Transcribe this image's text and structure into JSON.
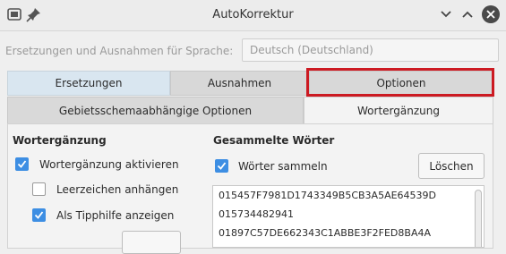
{
  "window": {
    "title": "AutoKorrektur"
  },
  "language": {
    "label": "Ersetzungen und Ausnahmen für Sprache:",
    "selected": "Deutsch (Deutschland)"
  },
  "tabs": {
    "row1": [
      "Ersetzungen",
      "Ausnahmen",
      "Optionen"
    ],
    "row2": [
      "Gebietsschemaabhängige Optionen",
      "Wortergänzung"
    ]
  },
  "left": {
    "heading": "Wortergänzung",
    "options": [
      {
        "label": "Wortergänzung aktivieren",
        "checked": true
      },
      {
        "label": "Leerzeichen anhängen",
        "checked": false
      },
      {
        "label": "Als Tipphilfe anzeigen",
        "checked": true
      }
    ]
  },
  "right": {
    "heading": "Gesammelte Wörter",
    "collect": {
      "label": "Wörter sammeln",
      "checked": true
    },
    "delete_button": "Löschen",
    "words": [
      "015457F7981D1743349B5CB3A5AE64539D",
      "015734482941",
      "01897C57DE662343C1ABBE3F2FED8BA4A"
    ]
  },
  "colors": {
    "accent": "#3d8ee3",
    "highlight": "#cc1a22"
  }
}
